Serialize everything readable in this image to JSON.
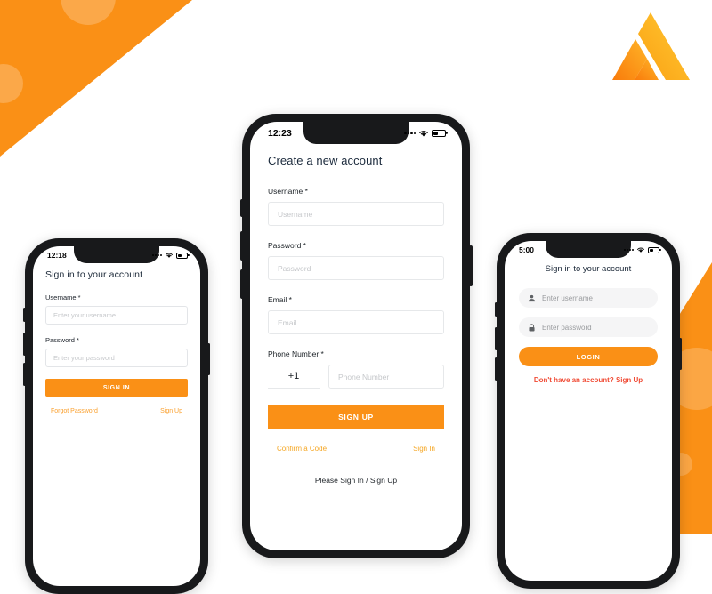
{
  "brand": {
    "logo_name": "aws-amplify-logo",
    "accent": "#FA9016",
    "accent_light": "#FFB938",
    "link_orange": "#F5A623",
    "link_red": "#F04B35",
    "heading_navy": "#1b2a3c"
  },
  "background": {
    "top_left_shape": "orange-triangle",
    "bottom_right_shape": "orange-triangle"
  },
  "phones": {
    "left": {
      "status": {
        "time": "12:18",
        "wifi": "wifi-icon",
        "battery": "battery-icon",
        "signal": "signal-dots-icon"
      },
      "title": "Sign in to your account",
      "fields": [
        {
          "label": "Username *",
          "placeholder": "Enter your username",
          "value": ""
        },
        {
          "label": "Password *",
          "placeholder": "Enter your password",
          "value": ""
        }
      ],
      "primary_button": "SIGN IN",
      "links": [
        "Forgot Password",
        "Sign Up"
      ]
    },
    "center": {
      "status": {
        "time": "12:23",
        "wifi": "wifi-icon",
        "battery": "battery-icon",
        "signal": "signal-dots-icon"
      },
      "title": "Create a new account",
      "fields": [
        {
          "label": "Username *",
          "placeholder": "Username",
          "value": ""
        },
        {
          "label": "Password *",
          "placeholder": "Password",
          "value": ""
        },
        {
          "label": "Email *",
          "placeholder": "Email",
          "value": ""
        }
      ],
      "phone_label": "Phone Number *",
      "country_code": "+1",
      "phone_placeholder": "Phone Number",
      "primary_button": "SIGN UP",
      "links": [
        "Confirm a Code",
        "Sign In"
      ],
      "footer": "Please Sign In / Sign Up"
    },
    "right": {
      "status": {
        "time": "5:00",
        "wifi": "wifi-icon",
        "battery": "battery-icon",
        "signal": "signal-dots-icon"
      },
      "title": "Sign in to your account",
      "fields": [
        {
          "icon": "person-icon",
          "placeholder": "Enter username",
          "value": ""
        },
        {
          "icon": "lock-icon",
          "placeholder": "Enter password",
          "value": ""
        }
      ],
      "primary_button": "LOGIN",
      "link": "Don't have an account? Sign Up"
    }
  }
}
